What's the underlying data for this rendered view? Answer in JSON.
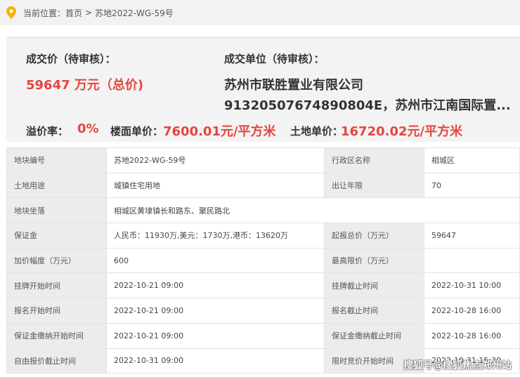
{
  "breadcrumb": {
    "prefix": "当前位置：",
    "home": "首页",
    "separator": ">",
    "current": "苏地2022-WG-59号"
  },
  "summary": {
    "price_label": "成交价（待审核）：",
    "price_value": "59647 万元（总价)",
    "buyer_label": "成交单位（待审核）：",
    "buyer_line1": "苏州市联胜置业有限公司",
    "buyer_line2": "91320507674890804E，苏州市江南国际置...",
    "premium_label": "溢价率：",
    "premium_value": "0%",
    "floor_price_label": "楼面单价：",
    "floor_price_value": "7600.01元/平方米",
    "land_price_label": "土地单价：",
    "land_price_value": "16720.02元/平方米"
  },
  "details": [
    {
      "k1": "地块编号",
      "v1": "苏地2022-WG-59号",
      "k2": "行政区名称",
      "v2": "相城区"
    },
    {
      "k1": "土地用途",
      "v1": "城镇住宅用地",
      "k2": "出让年限",
      "v2": "70"
    },
    {
      "k1": "地块坐落",
      "v1": "相城区黄埭镇长和路东、聚民路北"
    },
    {
      "k1": "保证金",
      "v1": "人民币：11930万,美元：1730万,港币：13620万",
      "k2": "起报总价（万元）",
      "v2": "59647"
    },
    {
      "k1": "加价幅度（万元）",
      "v1": "600",
      "k2": "最高限价（万元）",
      "v2": ""
    },
    {
      "k1": "挂牌开始时间",
      "v1": "2022-10-21 09:00",
      "k2": "挂牌截止时间",
      "v2": "2022-10-31 10:00"
    },
    {
      "k1": "报名开始时间",
      "v1": "2022-10-21 09:00",
      "k2": "报名截止时间",
      "v2": "2022-10-28 16:00"
    },
    {
      "k1": "保证金缴纳开始时间",
      "v1": "2022-10-21 09:00",
      "k2": "保证金缴纳截止时间",
      "v2": "2022-10-28 16:00"
    },
    {
      "k1": "自由报价截止时间",
      "v1": "2022-10-31 09:00",
      "k2": "限时竞价开始时间",
      "v2": "2022-10-31 15:30"
    }
  ],
  "watermark": "搜狐号@搜狐焦点郑州站",
  "colors": {
    "accent_red": "#e3463f",
    "pin_yellow": "#f5b400"
  },
  "icons": {
    "location": "location-pin-icon"
  }
}
